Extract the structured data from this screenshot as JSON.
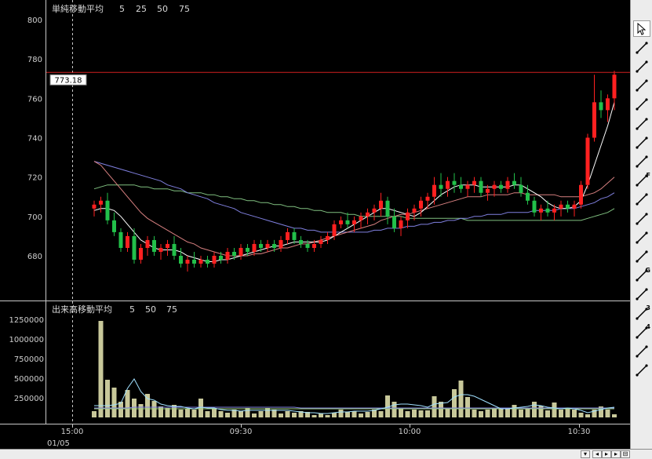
{
  "main_legend": {
    "title": "単純移動平均",
    "periods": [
      "5",
      "25",
      "50",
      "75"
    ]
  },
  "volume_legend": {
    "title": "出来高移動平均",
    "periods": [
      "5",
      "50",
      "75"
    ]
  },
  "price_label": "773.18",
  "date_label": "01/05",
  "colors": {
    "up": "#ff2020",
    "down": "#22c04a",
    "volume": "#c8c89a",
    "ma5": "#ffffff",
    "ma25": "#d88080",
    "ma50": "#8080e0",
    "ma75": "#80c080",
    "vma5": "#a0e0ff",
    "vma50": "#8080e0",
    "vma75": "#a0d080",
    "price_line": "#d02020",
    "grid": "#c8c8c8"
  },
  "toolbar": {
    "icons": [
      "cursor-arrow-icon",
      "eraser-icon",
      "horizontal-line-icon",
      "vertical-line-icon",
      "cross-lines-icon",
      "trend-line-icon",
      "angle-line-icon",
      "fan-lines-icon",
      "fibonacci-retracement-icon",
      "speed-lines-icon",
      "fibonacci-fan-icon",
      "horizontal-levels-icon",
      "ray-line-icon",
      "gann-angle-icon",
      "parallel-channel-icon",
      "three-line-icon",
      "four-line-icon",
      "columns-icon",
      "multi-point-icon"
    ],
    "labels": [
      "",
      "",
      "",
      "",
      "",
      "",
      "",
      "",
      "F",
      "",
      "",
      "",
      "",
      "G",
      "",
      "3",
      "4",
      "",
      ""
    ]
  },
  "chart_data": [
    {
      "type": "candlestick",
      "title": "単純移動平均",
      "ylim": [
        668,
        808
      ],
      "yticks": [
        680,
        700,
        720,
        740,
        760,
        780,
        800
      ],
      "x_ticks": [
        "15:00",
        "09:30",
        "10:00",
        "10:30"
      ],
      "current_price": 773.18,
      "ohlc": [
        [
          704,
          708,
          700,
          706
        ],
        [
          706,
          710,
          702,
          708
        ],
        [
          708,
          712,
          696,
          698
        ],
        [
          698,
          702,
          690,
          692
        ],
        [
          692,
          694,
          682,
          684
        ],
        [
          684,
          692,
          682,
          690
        ],
        [
          690,
          694,
          676,
          678
        ],
        [
          678,
          686,
          676,
          684
        ],
        [
          684,
          690,
          680,
          688
        ],
        [
          688,
          690,
          680,
          682
        ],
        [
          682,
          686,
          678,
          684
        ],
        [
          684,
          688,
          680,
          686
        ],
        [
          686,
          690,
          678,
          680
        ],
        [
          680,
          684,
          674,
          676
        ],
        [
          676,
          680,
          672,
          678
        ],
        [
          678,
          682,
          674,
          676
        ],
        [
          676,
          680,
          674,
          678
        ],
        [
          678,
          680,
          674,
          676
        ],
        [
          676,
          682,
          674,
          680
        ],
        [
          680,
          682,
          676,
          678
        ],
        [
          678,
          684,
          676,
          682
        ],
        [
          682,
          684,
          678,
          680
        ],
        [
          680,
          686,
          678,
          684
        ],
        [
          684,
          686,
          680,
          682
        ],
        [
          682,
          688,
          680,
          686
        ],
        [
          686,
          688,
          682,
          684
        ],
        [
          684,
          688,
          682,
          686
        ],
        [
          686,
          688,
          682,
          684
        ],
        [
          684,
          690,
          682,
          688
        ],
        [
          688,
          694,
          686,
          692
        ],
        [
          692,
          694,
          686,
          688
        ],
        [
          688,
          690,
          684,
          686
        ],
        [
          686,
          688,
          682,
          684
        ],
        [
          684,
          688,
          682,
          686
        ],
        [
          686,
          690,
          684,
          688
        ],
        [
          688,
          692,
          686,
          690
        ],
        [
          690,
          698,
          688,
          696
        ],
        [
          696,
          700,
          694,
          698
        ],
        [
          698,
          702,
          694,
          696
        ],
        [
          696,
          700,
          692,
          698
        ],
        [
          698,
          702,
          694,
          700
        ],
        [
          700,
          704,
          696,
          702
        ],
        [
          702,
          706,
          698,
          704
        ],
        [
          704,
          712,
          700,
          708
        ],
        [
          708,
          710,
          696,
          700
        ],
        [
          700,
          704,
          692,
          694
        ],
        [
          694,
          700,
          690,
          698
        ],
        [
          698,
          704,
          694,
          702
        ],
        [
          702,
          706,
          698,
          704
        ],
        [
          704,
          710,
          700,
          708
        ],
        [
          708,
          712,
          704,
          710
        ],
        [
          710,
          720,
          706,
          716
        ],
        [
          716,
          722,
          710,
          714
        ],
        [
          714,
          720,
          710,
          718
        ],
        [
          718,
          722,
          712,
          716
        ],
        [
          716,
          720,
          712,
          714
        ],
        [
          714,
          718,
          710,
          716
        ],
        [
          716,
          720,
          712,
          718
        ],
        [
          718,
          720,
          710,
          712
        ],
        [
          712,
          716,
          708,
          714
        ],
        [
          714,
          718,
          710,
          716
        ],
        [
          716,
          718,
          712,
          714
        ],
        [
          714,
          720,
          712,
          718
        ],
        [
          718,
          722,
          714,
          716
        ],
        [
          716,
          720,
          710,
          712
        ],
        [
          712,
          716,
          706,
          708
        ],
        [
          708,
          710,
          700,
          702
        ],
        [
          702,
          706,
          698,
          704
        ],
        [
          704,
          708,
          700,
          702
        ],
        [
          702,
          706,
          698,
          704
        ],
        [
          704,
          708,
          700,
          706
        ],
        [
          706,
          708,
          702,
          704
        ],
        [
          704,
          708,
          700,
          706
        ],
        [
          706,
          718,
          704,
          716
        ],
        [
          716,
          742,
          714,
          740
        ],
        [
          740,
          772,
          738,
          758
        ],
        [
          758,
          764,
          750,
          754
        ],
        [
          754,
          762,
          748,
          760
        ],
        [
          760,
          774,
          754,
          772
        ]
      ],
      "ma5": [
        703,
        704,
        704,
        703,
        700,
        696,
        692,
        688,
        686,
        684,
        683,
        683,
        683,
        682,
        680,
        679,
        678,
        677,
        677,
        678,
        678,
        679,
        680,
        681,
        682,
        683,
        684,
        685,
        685,
        686,
        687,
        687,
        687,
        687,
        687,
        688,
        690,
        692,
        694,
        696,
        698,
        700,
        702,
        704,
        704,
        703,
        702,
        701,
        700,
        702,
        705,
        708,
        711,
        713,
        715,
        716,
        716,
        716,
        715,
        715,
        715,
        715,
        715,
        716,
        716,
        714,
        712,
        710,
        707,
        705,
        704,
        704,
        705,
        708,
        716,
        726,
        736,
        746,
        758
      ],
      "ma25": [
        728,
        726,
        722,
        718,
        714,
        710,
        706,
        702,
        699,
        697,
        695,
        693,
        691,
        689,
        687,
        686,
        684,
        683,
        682,
        681,
        680,
        680,
        680,
        680,
        681,
        681,
        682,
        683,
        684,
        684,
        685,
        686,
        686,
        687,
        688,
        689,
        690,
        691,
        692,
        693,
        694,
        695,
        696,
        698,
        699,
        700,
        701,
        701,
        702,
        703,
        704,
        705,
        706,
        707,
        708,
        709,
        710,
        710,
        710,
        711,
        711,
        711,
        711,
        712,
        712,
        711,
        711,
        711,
        711,
        711,
        710,
        710,
        710,
        710,
        711,
        712,
        714,
        717,
        720
      ],
      "ma50": [
        728,
        727,
        726,
        725,
        724,
        723,
        722,
        721,
        720,
        719,
        718,
        716,
        715,
        714,
        712,
        711,
        710,
        709,
        707,
        706,
        705,
        704,
        702,
        701,
        700,
        699,
        698,
        697,
        696,
        695,
        694,
        694,
        693,
        693,
        692,
        692,
        692,
        692,
        692,
        692,
        692,
        692,
        693,
        693,
        694,
        694,
        694,
        695,
        695,
        696,
        696,
        697,
        697,
        698,
        698,
        699,
        699,
        700,
        700,
        701,
        701,
        701,
        702,
        702,
        702,
        702,
        703,
        703,
        703,
        703,
        704,
        704,
        704,
        705,
        706,
        707,
        709,
        710,
        712
      ],
      "ma75": [
        714,
        715,
        716,
        716,
        716,
        716,
        716,
        715,
        715,
        714,
        714,
        714,
        713,
        713,
        712,
        712,
        712,
        711,
        711,
        710,
        710,
        709,
        709,
        708,
        708,
        707,
        707,
        706,
        706,
        705,
        705,
        704,
        704,
        703,
        703,
        702,
        702,
        702,
        701,
        701,
        700,
        700,
        700,
        700,
        700,
        700,
        700,
        699,
        699,
        699,
        699,
        699,
        699,
        699,
        699,
        699,
        698,
        698,
        698,
        698,
        698,
        698,
        698,
        698,
        698,
        698,
        698,
        698,
        698,
        698,
        698,
        698,
        698,
        698,
        699,
        700,
        701,
        702,
        704
      ]
    },
    {
      "type": "bar",
      "title": "出来高移動平均",
      "ylim": [
        0,
        1350000
      ],
      "yticks": [
        250000,
        500000,
        750000,
        1000000,
        1250000
      ],
      "volume": [
        80000,
        1230000,
        480000,
        380000,
        200000,
        350000,
        240000,
        170000,
        300000,
        210000,
        140000,
        120000,
        160000,
        100000,
        110000,
        100000,
        240000,
        80000,
        120000,
        80000,
        60000,
        100000,
        80000,
        120000,
        50000,
        80000,
        120000,
        100000,
        50000,
        80000,
        60000,
        80000,
        70000,
        30000,
        50000,
        30000,
        60000,
        100000,
        70000,
        80000,
        50000,
        70000,
        100000,
        80000,
        280000,
        200000,
        120000,
        80000,
        100000,
        90000,
        90000,
        270000,
        200000,
        120000,
        360000,
        470000,
        260000,
        100000,
        80000,
        100000,
        120000,
        110000,
        110000,
        160000,
        100000,
        120000,
        200000,
        150000,
        90000,
        190000,
        100000,
        120000,
        100000,
        60000,
        40000,
        100000,
        140000,
        100000,
        40000
      ],
      "vma5": [
        150000,
        150000,
        150000,
        160000,
        180000,
        370000,
        490000,
        330000,
        240000,
        220000,
        170000,
        150000,
        140000,
        140000,
        120000,
        110000,
        130000,
        120000,
        120000,
        100000,
        90000,
        90000,
        80000,
        90000,
        90000,
        90000,
        90000,
        90000,
        90000,
        90000,
        80000,
        70000,
        60000,
        60000,
        50000,
        50000,
        60000,
        70000,
        70000,
        80000,
        80000,
        80000,
        90000,
        110000,
        130000,
        160000,
        170000,
        170000,
        160000,
        150000,
        130000,
        170000,
        180000,
        190000,
        260000,
        290000,
        290000,
        270000,
        230000,
        190000,
        150000,
        110000,
        110000,
        120000,
        130000,
        140000,
        160000,
        150000,
        130000,
        120000,
        110000,
        120000,
        110000,
        90000,
        60000,
        80000,
        100000,
        120000,
        130000
      ],
      "vma50": [
        120000,
        120000,
        120000,
        120000,
        120000,
        120000,
        130000,
        130000,
        130000,
        130000,
        130000,
        130000,
        130000,
        130000,
        130000,
        130000,
        130000,
        130000,
        130000,
        130000,
        130000,
        130000,
        130000,
        130000,
        130000,
        130000,
        130000,
        130000,
        130000,
        130000,
        130000,
        120000,
        120000,
        120000,
        120000,
        120000,
        120000,
        120000,
        120000,
        120000,
        120000,
        120000,
        120000,
        120000,
        120000,
        120000,
        120000,
        120000,
        120000,
        120000,
        120000,
        120000,
        120000,
        120000,
        120000,
        120000,
        120000,
        120000,
        120000,
        120000,
        120000,
        120000,
        120000,
        120000,
        120000,
        120000,
        120000,
        120000,
        120000,
        120000,
        120000,
        120000,
        120000,
        120000,
        120000,
        120000,
        120000,
        120000,
        120000
      ],
      "vma75": [
        110000,
        110000,
        110000,
        110000,
        110000,
        110000,
        110000,
        110000,
        110000,
        110000,
        110000,
        110000,
        110000,
        110000,
        110000,
        110000,
        110000,
        110000,
        110000,
        110000,
        110000,
        110000,
        110000,
        110000,
        110000,
        110000,
        110000,
        110000,
        110000,
        110000,
        110000,
        110000,
        110000,
        110000,
        110000,
        110000,
        110000,
        110000,
        110000,
        110000,
        110000,
        110000,
        110000,
        110000,
        110000,
        110000,
        110000,
        110000,
        110000,
        110000,
        110000,
        110000,
        110000,
        110000,
        110000,
        110000,
        110000,
        110000,
        110000,
        110000,
        110000,
        110000,
        110000,
        110000,
        110000,
        110000,
        110000,
        110000,
        110000,
        110000,
        110000,
        110000,
        110000,
        110000,
        110000,
        110000,
        110000,
        110000,
        110000
      ]
    }
  ]
}
